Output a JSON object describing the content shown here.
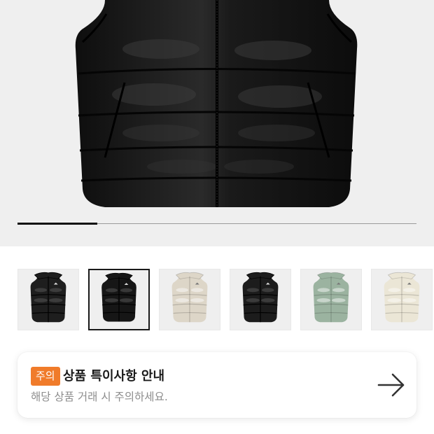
{
  "hero": {
    "image": "black-puffer-vest-front",
    "carousel_progress": 0.2
  },
  "thumbnails": [
    {
      "name": "black-vest-matte",
      "color": "#1e1e1e",
      "selected": false
    },
    {
      "name": "black-vest-glossy",
      "color": "#161616",
      "selected": true
    },
    {
      "name": "beige-vest",
      "color": "#ddd6c8",
      "selected": false
    },
    {
      "name": "black-vest-2",
      "color": "#1c1c1c",
      "selected": false
    },
    {
      "name": "sage-green-vest",
      "color": "#9bb3a0",
      "selected": false
    },
    {
      "name": "cream-vest",
      "color": "#ebe6d6",
      "selected": false
    }
  ],
  "notice": {
    "badge": "주의",
    "title": "상품 특이사항 안내",
    "description": "해당 상품 거래 시 주의하세요.",
    "arrow_icon": "arrow-right-icon",
    "badge_color": "#f07b2a"
  }
}
